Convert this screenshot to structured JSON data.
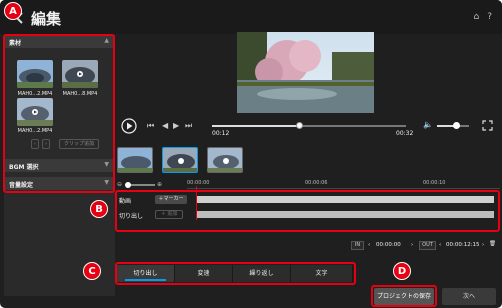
{
  "window": {
    "title": "編集"
  },
  "title_icons": {
    "icon1": "⌂",
    "icon2": "?"
  },
  "left_panel": {
    "materials_label": "素材",
    "clips": [
      {
        "label": "MAH0...2.MP4"
      },
      {
        "label": "MAH0...8.MP4"
      },
      {
        "label": "MAH0...2.MP4"
      }
    ],
    "add_clip_label": "クリップ追加",
    "bgm_label": "BGM 選択",
    "audio_label": "音量設定"
  },
  "player": {
    "current_time": "00:12",
    "total_time": "00:32",
    "progress": 0.45,
    "volume": 0.6
  },
  "timeline": {
    "ruler_ticks": [
      "00:00:00",
      "00:00:06",
      "00:00:10"
    ],
    "video_track_label": "動画",
    "marker_button": "＋マーカー",
    "cut_track_label": "切り出し",
    "add_button": "＋ 追加"
  },
  "inout": {
    "in_label": "IN",
    "in_time": "00:00:00",
    "out_label": "OUT",
    "out_time": "00:00:12:15"
  },
  "tabs": [
    "切り出し",
    "変速",
    "繰り返し",
    "文字"
  ],
  "actions": {
    "save_project": "プロジェクトの保存",
    "next": "次へ"
  },
  "annotations": {
    "a": "A",
    "b": "B",
    "c": "C",
    "d": "D"
  },
  "colors": {
    "accent": "#00a0e9",
    "annotation": "#e60012"
  }
}
